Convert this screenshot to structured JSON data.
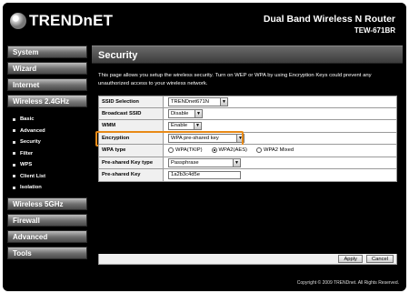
{
  "header": {
    "brand": "TRENDnET",
    "product_name": "Dual Band Wireless N Router",
    "model": "TEW-671BR"
  },
  "sidebar": {
    "items": [
      {
        "label": "System"
      },
      {
        "label": "Wizard"
      },
      {
        "label": "Internet"
      },
      {
        "label": "Wireless 2.4GHz",
        "active": true
      }
    ],
    "sub_items": [
      {
        "label": "Basic"
      },
      {
        "label": "Advanced"
      },
      {
        "label": "Security"
      },
      {
        "label": "Filter"
      },
      {
        "label": "WPS"
      },
      {
        "label": "Client List"
      },
      {
        "label": "Isolation"
      }
    ],
    "items_after": [
      {
        "label": "Wireless 5GHz"
      },
      {
        "label": "Firewall"
      },
      {
        "label": "Advanced"
      },
      {
        "label": "Tools"
      }
    ]
  },
  "main": {
    "title": "Security",
    "description": "This page allows you setup the wireless security. Turn on WEP or WPA by using Encryption Keys could prevent any unauthorized access to your wireless network.",
    "fields": {
      "ssid_selection": {
        "label": "SSID Selection",
        "value": "TRENDnet671N"
      },
      "broadcast_ssid": {
        "label": "Broadcast SSID",
        "value": "Disable"
      },
      "wmm": {
        "label": "WMM",
        "value": "Enable"
      },
      "encryption": {
        "label": "Encryption",
        "value": "WPA pre-shared key"
      },
      "wpa_type": {
        "label": "WPA type",
        "options": [
          {
            "label": "WPA(TKIP)",
            "selected": false
          },
          {
            "label": "WPA2(AES)",
            "selected": true
          },
          {
            "label": "WPA2 Mixed",
            "selected": false
          }
        ]
      },
      "psk_type": {
        "label": "Pre-shared Key type",
        "value": "Passphrase"
      },
      "psk": {
        "label": "Pre-shared Key",
        "value": "1a2b3c4d5e"
      }
    },
    "apply_label": "Apply",
    "cancel_label": "Cancel"
  },
  "footer": {
    "copyright": "Copyright © 2009 TRENDnet. All Rights Reserved."
  },
  "colors": {
    "highlight": "#e88a17",
    "background": "#000000"
  }
}
